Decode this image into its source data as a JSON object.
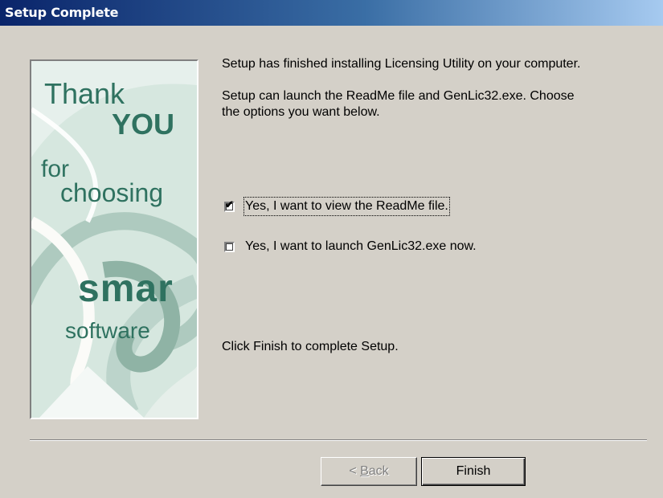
{
  "window": {
    "title": "Setup Complete"
  },
  "banner": {
    "lines": [
      "Thank",
      "YOU",
      "for",
      "choosing",
      "smar",
      "software"
    ]
  },
  "content": {
    "line1": "Setup has finished installing Licensing Utility on your computer.",
    "line2a": "Setup can launch the ReadMe file and GenLic32.exe. Choose",
    "line2b": "the options you want below.",
    "option_readme": {
      "label": "Yes, I want to view the ReadMe file.",
      "checked": true
    },
    "option_launch": {
      "label": "Yes, I want to launch GenLic32.exe now.",
      "checked": false
    },
    "finish_hint": "Click Finish to complete Setup."
  },
  "buttons": {
    "back_prefix": "< ",
    "back_mnemonic": "B",
    "back_rest": "ack",
    "finish": "Finish"
  },
  "colors": {
    "accent_green": "#2f7260",
    "banner_bg": "#cfe1d9",
    "dialog_bg": "#d4d0c8"
  }
}
